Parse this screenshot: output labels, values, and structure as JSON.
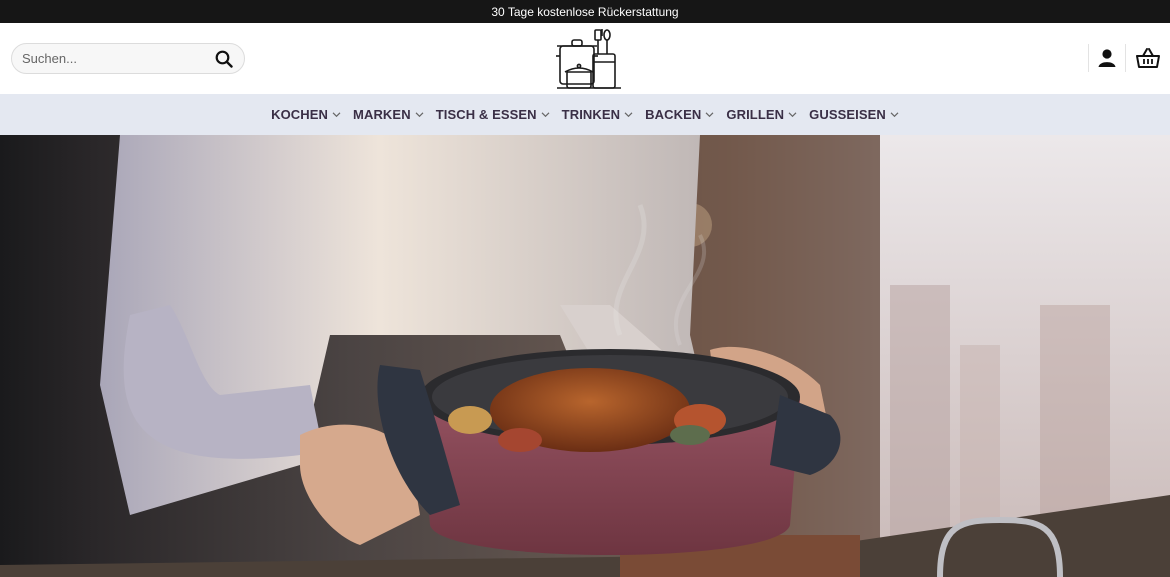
{
  "announcement": {
    "text": "30 Tage kostenlose Rückerstattung"
  },
  "search": {
    "placeholder": "Suchen..."
  },
  "icons": {
    "search": "search-icon",
    "account": "user-icon",
    "cart": "basket-icon",
    "logo": "cookware-logo"
  },
  "nav": {
    "items": [
      {
        "label": "KOCHEN"
      },
      {
        "label": "MARKEN"
      },
      {
        "label": "TISCH & ESSEN"
      },
      {
        "label": "TRINKEN"
      },
      {
        "label": "BACKEN"
      },
      {
        "label": "GRILLEN"
      },
      {
        "label": "GUSSEISEN"
      }
    ]
  },
  "colors": {
    "topbar": "#161616",
    "nav_background": "#e4e8f1",
    "nav_text": "#3a2f46",
    "pot": "#8a4a58"
  }
}
